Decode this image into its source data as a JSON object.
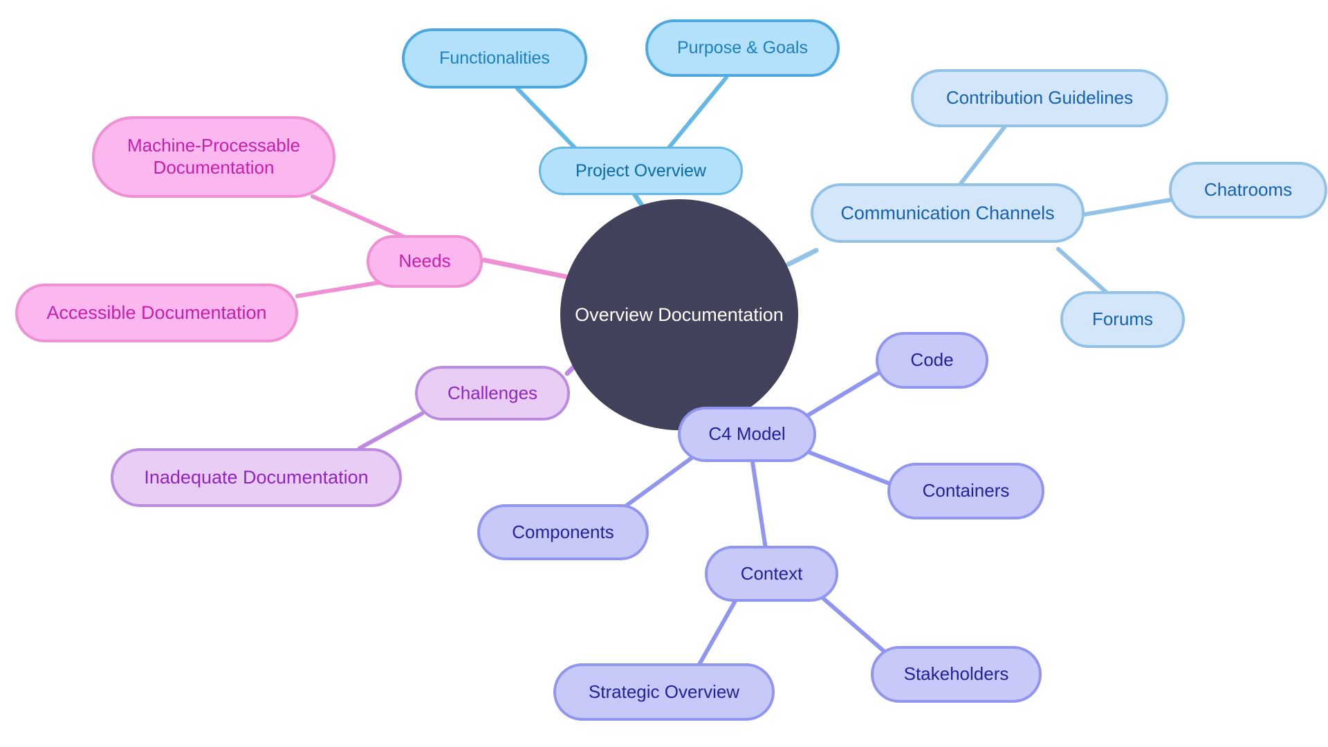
{
  "diagram": {
    "title": "Overview Documentation",
    "type": "mindmap",
    "background": "#ffffff"
  },
  "palette": {
    "central_fill": "#41415c",
    "central_text": "#ffffff",
    "blue_branch_fill": "#b3e0fa",
    "blue_branch_border": "#63b8e8",
    "blue_branch_text": "#0b6ba8",
    "blue_leaf_fill": "#d3e6fa",
    "blue_leaf_border": "#92c2e8",
    "blue_leaf_text": "#1461b5",
    "pink_fill": "#fbb8ee",
    "pink_border": "#ef8fd4",
    "pink_text": "#c81eaa",
    "violet_fill": "#e8cdf5",
    "violet_border": "#bd8ae2",
    "violet_text": "#9124c4",
    "indigo_fill": "#c7c9f9",
    "indigo_border": "#9096ef",
    "indigo_text": "#22219c"
  },
  "nodes": {
    "central": {
      "label": "Overview Documentation"
    },
    "project_overview": {
      "label": "Project Overview"
    },
    "functionalities": {
      "label": "Functionalities"
    },
    "purpose_goals": {
      "label": "Purpose & Goals"
    },
    "communication_channels": {
      "label": "Communication Channels"
    },
    "contribution_guidelines": {
      "label": "Contribution Guidelines"
    },
    "chatrooms": {
      "label": "Chatrooms"
    },
    "forums": {
      "label": "Forums"
    },
    "needs": {
      "label": "Needs"
    },
    "machine_processable": {
      "label": "Machine-Processable\nDocumentation"
    },
    "accessible_documentation": {
      "label": "Accessible Documentation"
    },
    "challenges": {
      "label": "Challenges"
    },
    "inadequate_documentation": {
      "label": "Inadequate Documentation"
    },
    "c4_model": {
      "label": "C4 Model"
    },
    "code": {
      "label": "Code"
    },
    "containers": {
      "label": "Containers"
    },
    "context": {
      "label": "Context"
    },
    "components": {
      "label": "Components"
    },
    "strategic_overview": {
      "label": "Strategic Overview"
    },
    "stakeholders": {
      "label": "Stakeholders"
    }
  },
  "chart_data": {
    "type": "mindmap",
    "title": "Overview Documentation",
    "root": "Overview Documentation",
    "branches": [
      {
        "name": "Project Overview",
        "color": "#b3e0fa",
        "children": [
          "Functionalities",
          "Purpose & Goals"
        ]
      },
      {
        "name": "Communication Channels",
        "color": "#d3e6fa",
        "children": [
          "Contribution Guidelines",
          "Chatrooms",
          "Forums"
        ]
      },
      {
        "name": "Needs",
        "color": "#fbb8ee",
        "children": [
          "Machine-Processable Documentation",
          "Accessible Documentation"
        ]
      },
      {
        "name": "Challenges",
        "color": "#e8cdf5",
        "children": [
          "Inadequate Documentation"
        ]
      },
      {
        "name": "C4 Model",
        "color": "#c7c9f9",
        "children": [
          "Code",
          "Containers",
          "Context",
          "Components"
        ]
      },
      {
        "name": "Context",
        "color": "#c7c9f9",
        "children": [
          "Strategic Overview",
          "Stakeholders"
        ]
      }
    ],
    "edges": [
      [
        "Overview Documentation",
        "Project Overview"
      ],
      [
        "Overview Documentation",
        "Communication Channels"
      ],
      [
        "Overview Documentation",
        "Needs"
      ],
      [
        "Overview Documentation",
        "Challenges"
      ],
      [
        "Overview Documentation",
        "C4 Model"
      ],
      [
        "Project Overview",
        "Functionalities"
      ],
      [
        "Project Overview",
        "Purpose & Goals"
      ],
      [
        "Communication Channels",
        "Contribution Guidelines"
      ],
      [
        "Communication Channels",
        "Chatrooms"
      ],
      [
        "Communication Channels",
        "Forums"
      ],
      [
        "Needs",
        "Machine-Processable Documentation"
      ],
      [
        "Needs",
        "Accessible Documentation"
      ],
      [
        "Challenges",
        "Inadequate Documentation"
      ],
      [
        "C4 Model",
        "Code"
      ],
      [
        "C4 Model",
        "Containers"
      ],
      [
        "C4 Model",
        "Context"
      ],
      [
        "C4 Model",
        "Components"
      ],
      [
        "Context",
        "Strategic Overview"
      ],
      [
        "Context",
        "Stakeholders"
      ]
    ]
  }
}
